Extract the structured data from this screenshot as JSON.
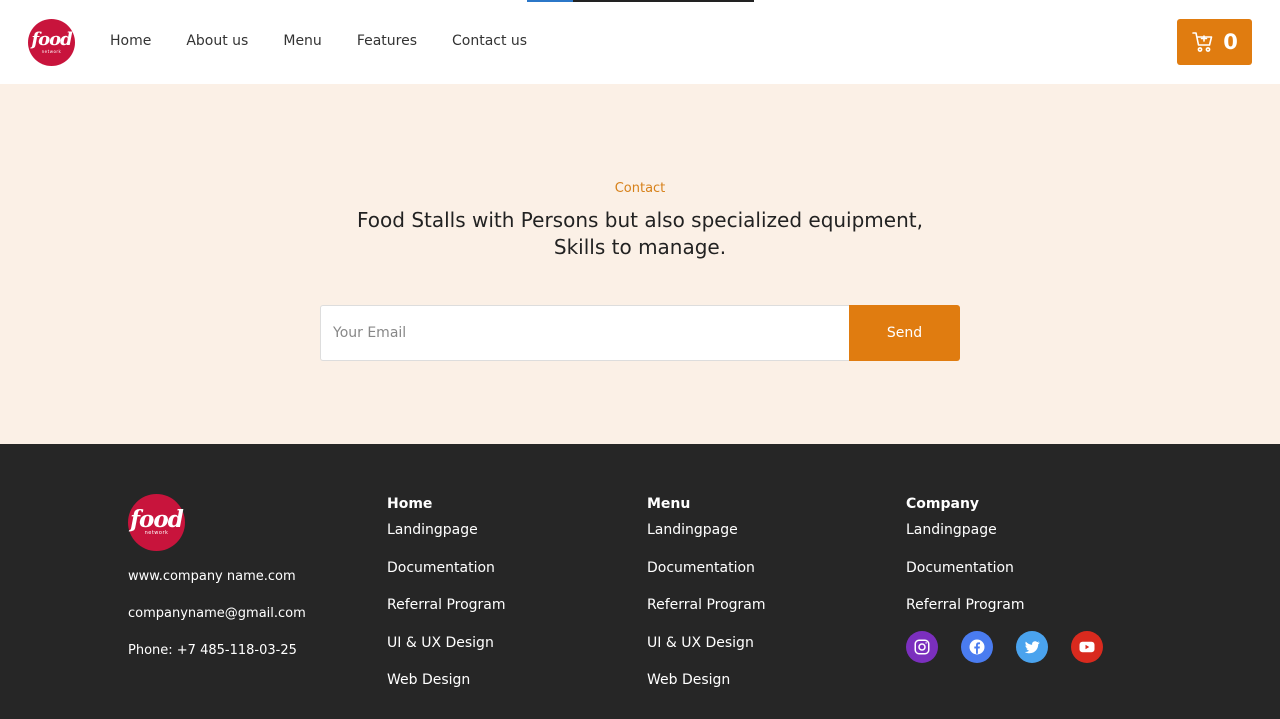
{
  "header": {
    "logo": {
      "word": "food",
      "sub": "network"
    },
    "nav": [
      "Home",
      "About us",
      "Menu",
      "Features",
      "Contact us"
    ],
    "cart": {
      "icon": "cart-icon",
      "count": "0"
    }
  },
  "contact": {
    "eyebrow": "Contact",
    "headline_line1": "Food Stalls with Persons but also specialized equipment,",
    "headline_line2": "Skills to manage.",
    "email_placeholder": "Your Email",
    "send_label": "Send"
  },
  "footer": {
    "logo": {
      "word": "food",
      "sub": "network"
    },
    "website": "www.company name.com",
    "email": "companyname@gmail.com",
    "phone": "Phone: +7 485-118-03-25",
    "columns": [
      {
        "title": "Home",
        "links": [
          "Landingpage",
          "Documentation",
          "Referral Program",
          "UI & UX Design",
          "Web Design"
        ]
      },
      {
        "title": "Menu",
        "links": [
          "Landingpage",
          "Documentation",
          "Referral Program",
          "UI & UX Design",
          "Web Design"
        ]
      },
      {
        "title": "Company",
        "links": [
          "Landingpage",
          "Documentation",
          "Referral Program"
        ]
      }
    ],
    "socials": [
      {
        "name": "instagram-icon",
        "color": "#7b2fbe"
      },
      {
        "name": "facebook-icon",
        "color": "#4a7cf0"
      },
      {
        "name": "twitter-icon",
        "color": "#4aa3ee"
      },
      {
        "name": "youtube-icon",
        "color": "#d92a1e"
      }
    ]
  },
  "colors": {
    "accent": "#e07c10",
    "hero_bg": "#fbf0e6",
    "footer_bg": "#262626",
    "logo_red": "#c8143c"
  }
}
